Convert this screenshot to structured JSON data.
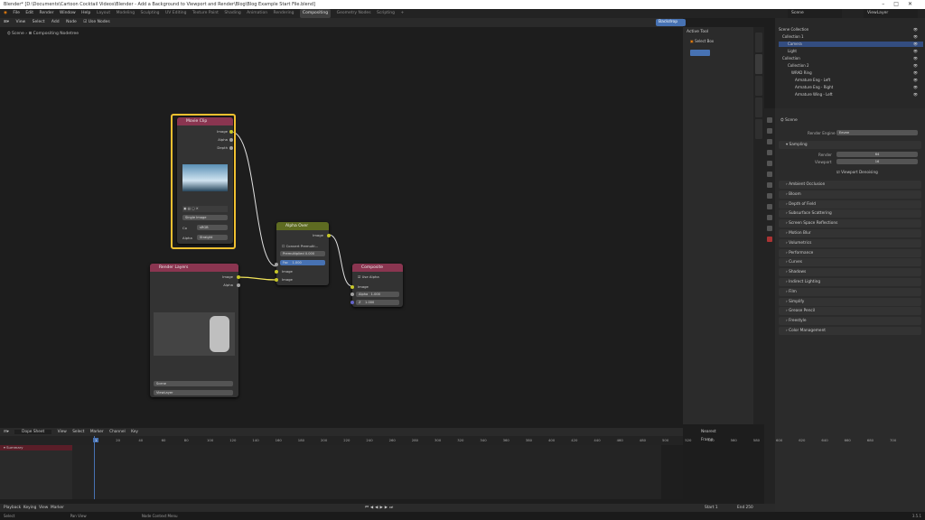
{
  "window": {
    "title": "Blender* [D:\\Documents\\Cartoon Cocktail Videos\\Blender - Add a Background to Viewport and Render\\Blog\\Blog Example Start File.blend]"
  },
  "menu": [
    "File",
    "Edit",
    "Render",
    "Window",
    "Help"
  ],
  "workspaces": [
    "Layout",
    "Modeling",
    "Sculpting",
    "UV Editing",
    "Texture Paint",
    "Shading",
    "Animation",
    "Rendering",
    "Compositing",
    "Geometry Nodes",
    "Scripting"
  ],
  "active_workspace": "Compositing",
  "scene_field": "Scene",
  "view_layer_field": "ViewLayer",
  "node_editor": {
    "menus": [
      "View",
      "Select",
      "Add",
      "Node"
    ],
    "use_nodes_label": "Use Nodes",
    "breadcrumb": [
      "Scene",
      "Compositing Nodetree"
    ],
    "backdrop_label": "Backdrop"
  },
  "npanel": {
    "header": "Active Tool",
    "tool": "Select Box"
  },
  "nodes": {
    "movieclip": {
      "title": "Movie Clip",
      "outputs": [
        "Image",
        "Alpha",
        "Depth"
      ],
      "mode": "Single Image",
      "color_space_label": "Co",
      "color_space_value": "sRGB",
      "alpha_label": "Alpha",
      "alpha_value": "Straight"
    },
    "render_layers": {
      "title": "Render Layers",
      "outputs": [
        "Image",
        "Alpha"
      ],
      "scene": "Scene",
      "layer": "ViewLayer"
    },
    "alpha_over": {
      "title": "Alpha Over",
      "output": "Image",
      "convert_label": "Convert Premulti...",
      "premul_label": "Premultiplied",
      "premul_value": "0.000",
      "fac_label": "Fac",
      "fac_value": "1.000",
      "inputs": [
        "Image",
        "Image"
      ]
    },
    "composite": {
      "title": "Composite",
      "use_alpha": "Use Alpha",
      "input": "Image",
      "alpha_label": "Alpha",
      "alpha_value": "1.000",
      "z_label": "Z",
      "z_value": "1.000"
    }
  },
  "outliner": {
    "rows": [
      {
        "label": "Scene Collection",
        "selected": false
      },
      {
        "label": "Collection 1",
        "selected": false
      },
      {
        "label": "Camera",
        "selected": true
      },
      {
        "label": "Light",
        "selected": false
      },
      {
        "label": "Collection",
        "selected": false
      },
      {
        "label": "Collection 2",
        "selected": false
      },
      {
        "label": "WRAD Ring",
        "selected": false
      },
      {
        "label": "Armature Eng - Left",
        "selected": false
      },
      {
        "label": "Armature Eng - Right",
        "selected": false
      },
      {
        "label": "Armature Wing - Left",
        "selected": false
      }
    ]
  },
  "properties": {
    "scene": "Scene",
    "render_engine_label": "Render Engine",
    "render_engine": "Eevee",
    "sampling": "Sampling",
    "render_label": "Render",
    "render_value": "64",
    "viewport_label": "Viewport",
    "viewport_value": "16",
    "viewport_denoising": "Viewport Denoising",
    "panels": [
      "Ambient Occlusion",
      "Bloom",
      "Depth of Field",
      "Subsurface Scattering",
      "Screen Space Reflections",
      "Motion Blur",
      "Volumetrics",
      "Performance",
      "Curves",
      "Shadows",
      "Indirect Lighting",
      "Film",
      "Simplify",
      "Grease Pencil",
      "Freestyle",
      "Color Management"
    ]
  },
  "timeline": {
    "mode": "Dope Sheet",
    "menus": [
      "View",
      "Select",
      "Marker",
      "Channel",
      "Key"
    ],
    "filter": "Nearest Frame",
    "summary": "Summary",
    "ticks": [
      "1",
      "20",
      "40",
      "60",
      "80",
      "100",
      "120",
      "140",
      "160",
      "180",
      "200",
      "220",
      "240",
      "260",
      "280",
      "300",
      "320",
      "340",
      "360",
      "380",
      "400",
      "420",
      "440",
      "460",
      "480",
      "500",
      "520",
      "540",
      "560",
      "580",
      "600",
      "620",
      "640",
      "660",
      "680",
      "700"
    ],
    "current_frame": "1"
  },
  "playback": {
    "items": [
      "Playback",
      "Keying",
      "View",
      "Marker"
    ],
    "start_label": "Start",
    "start": "1",
    "end_label": "End",
    "end": "250"
  },
  "status": {
    "select": "Select",
    "pan": "Pan View",
    "node": "Node Context Menu",
    "version": "3.5.1"
  }
}
